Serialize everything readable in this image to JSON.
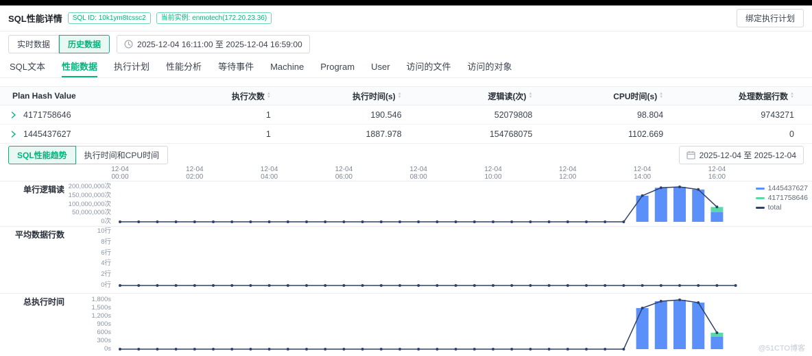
{
  "colors": {
    "accent": "#00b57d",
    "accent_bg": "#e9f8f2",
    "bar_blue": "#5b8ff9",
    "bar_green": "#5ad8a6",
    "line_dark": "#2e4168"
  },
  "header": {
    "title": "SQL性能详情",
    "sql_id_badge": "SQL ID: 10k1ym8tcssc2",
    "instance_badge": "当前实例: enmotech(172.20.23.36)",
    "bind_plan_button": "绑定执行计划"
  },
  "toolbar": {
    "realtime_label": "实时数据",
    "history_label": "历史数据",
    "time_range": "2025-12-04 16:11:00 至 2025-12-04 16:59:00"
  },
  "tabs": [
    {
      "label": "SQL文本",
      "active": false
    },
    {
      "label": "性能数据",
      "active": true
    },
    {
      "label": "执行计划",
      "active": false
    },
    {
      "label": "性能分析",
      "active": false
    },
    {
      "label": "等待事件",
      "active": false
    },
    {
      "label": "Machine",
      "active": false
    },
    {
      "label": "Program",
      "active": false
    },
    {
      "label": "User",
      "active": false
    },
    {
      "label": "访问的文件",
      "active": false
    },
    {
      "label": "访问的对象",
      "active": false
    }
  ],
  "table": {
    "columns": [
      "Plan Hash Value",
      "执行次数",
      "执行时间(s)",
      "逻辑读(次)",
      "CPU时间(s)",
      "处理数据行数"
    ],
    "rows": [
      [
        "4171758646",
        "1",
        "190.546",
        "52079808",
        "98.804",
        "9743271"
      ],
      [
        "1445437627",
        "1",
        "1887.978",
        "154768075",
        "1102.669",
        "0"
      ]
    ]
  },
  "chart_controls": {
    "trend_label": "SQL性能趋势",
    "exec_cpu_label": "执行时间和CPU时间",
    "date_range": "2025-12-04 至 2025-12-04"
  },
  "legend": [
    {
      "label": "1445437627",
      "color": "#5b8ff9"
    },
    {
      "label": "4171758646",
      "color": "#5ad8a6"
    },
    {
      "label": "total",
      "color": "#2e4168"
    }
  ],
  "time_axis": {
    "date": "12-04",
    "times": [
      "00:00",
      "02:00",
      "04:00",
      "06:00",
      "08:00",
      "10:00",
      "12:00",
      "14:00",
      "16:00"
    ]
  },
  "chart_data": [
    {
      "type": "bar",
      "name": "单行逻辑读",
      "y_ticks": [
        "200,000,000次",
        "150,000,000次",
        "100,000,000次",
        "50,000,000次",
        "0次"
      ],
      "y_max": 200000000,
      "line": {
        "name": "total",
        "start_minute": 0,
        "step_minutes": 30,
        "values": [
          0,
          0,
          0,
          0,
          0,
          0,
          0,
          0,
          0,
          0,
          0,
          0,
          0,
          0,
          0,
          0,
          0,
          0,
          0,
          0,
          0,
          0,
          0,
          0,
          0,
          0,
          0,
          0,
          150000000,
          195000000,
          200000000,
          185000000,
          85000000
        ]
      },
      "bars": [
        {
          "time": "14:00",
          "series_1445437627": 150000000,
          "series_4171758646": 0
        },
        {
          "time": "14:30",
          "series_1445437627": 195000000,
          "series_4171758646": 0
        },
        {
          "time": "15:00",
          "series_1445437627": 200000000,
          "series_4171758646": 0
        },
        {
          "time": "15:30",
          "series_1445437627": 185000000,
          "series_4171758646": 0
        },
        {
          "time": "16:00",
          "series_1445437627": 55000000,
          "series_4171758646": 30000000
        }
      ]
    },
    {
      "type": "line",
      "name": "平均数据行数",
      "y_ticks": [
        "10行",
        "8行",
        "6行",
        "4行",
        "2行",
        "0行"
      ],
      "y_max": 10,
      "line": {
        "name": "total",
        "start_minute": 0,
        "step_minutes": 30,
        "values": [
          0,
          0,
          0,
          0,
          0,
          0,
          0,
          0,
          0,
          0,
          0,
          0,
          0,
          0,
          0,
          0,
          0,
          0,
          0,
          0,
          0,
          0,
          0,
          0,
          0,
          0,
          0,
          0,
          0,
          0,
          0,
          0,
          0,
          0
        ]
      },
      "bars": []
    },
    {
      "type": "bar",
      "name": "总执行时间",
      "y_ticks": [
        "1,800s",
        "1,500s",
        "1,200s",
        "900s",
        "600s",
        "300s",
        "0s"
      ],
      "y_max": 1800,
      "line": {
        "name": "total",
        "start_minute": 0,
        "step_minutes": 30,
        "values": [
          0,
          0,
          0,
          0,
          0,
          0,
          0,
          0,
          0,
          0,
          0,
          0,
          0,
          0,
          0,
          0,
          0,
          0,
          0,
          0,
          0,
          0,
          0,
          0,
          0,
          0,
          0,
          0,
          1500,
          1750,
          1800,
          1700,
          600
        ]
      },
      "bars": [
        {
          "time": "14:00",
          "series_1445437627": 1500,
          "series_4171758646": 0
        },
        {
          "time": "14:30",
          "series_1445437627": 1750,
          "series_4171758646": 0
        },
        {
          "time": "15:00",
          "series_1445437627": 1800,
          "series_4171758646": 0
        },
        {
          "time": "15:30",
          "series_1445437627": 1700,
          "series_4171758646": 0
        },
        {
          "time": "16:00",
          "series_1445437627": 450,
          "series_4171758646": 150
        }
      ]
    }
  ],
  "watermark": "@51CTO博客"
}
